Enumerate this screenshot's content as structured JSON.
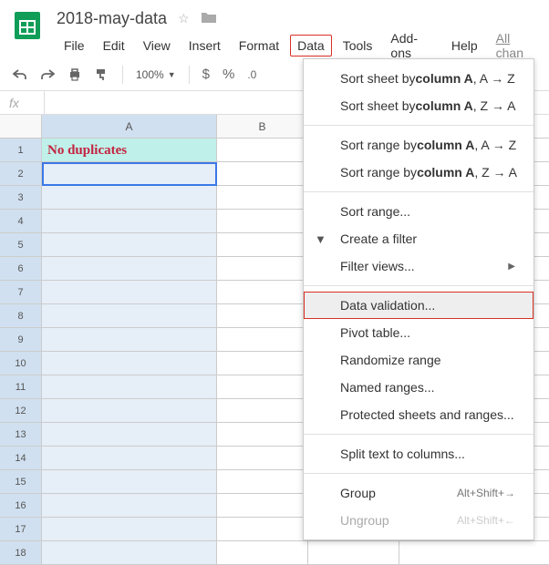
{
  "doc_title": "2018-may-data",
  "menubar": {
    "file": "File",
    "edit": "Edit",
    "view": "View",
    "insert": "Insert",
    "format": "Format",
    "data": "Data",
    "tools": "Tools",
    "addons": "Add-ons",
    "help": "Help",
    "changes": "All chan"
  },
  "toolbar": {
    "zoom": "100%",
    "currency": "$",
    "percent": "%",
    "round0": ".0"
  },
  "fx_label": "fx",
  "cols": {
    "A": "A",
    "B": "B",
    "C": ""
  },
  "rows": [
    "1",
    "2",
    "3",
    "4",
    "5",
    "6",
    "7",
    "8",
    "9",
    "10",
    "11",
    "12",
    "13",
    "14",
    "15",
    "16",
    "17",
    "18"
  ],
  "cell_a1": "No duplicates",
  "menu": {
    "sort_sheet_az_pre": "Sort sheet by ",
    "sort_sheet_az_bold": "column A",
    "sort_sheet_az_post": ", A → Z",
    "sort_sheet_za_pre": "Sort sheet by ",
    "sort_sheet_za_bold": "column A",
    "sort_sheet_za_post": ", Z → A",
    "sort_range_az_pre": "Sort range by ",
    "sort_range_az_bold": "column A",
    "sort_range_az_post": ", A → Z",
    "sort_range_za_pre": "Sort range by ",
    "sort_range_za_bold": "column A",
    "sort_range_za_post": ", Z → A",
    "sort_range": "Sort range...",
    "create_filter": "Create a filter",
    "filter_views": "Filter views...",
    "data_validation": "Data validation...",
    "pivot_table": "Pivot table...",
    "randomize": "Randomize range",
    "named_ranges": "Named ranges...",
    "protected": "Protected sheets and ranges...",
    "split": "Split text to columns...",
    "group": "Group",
    "group_shortcut": "Alt+Shift+→",
    "ungroup": "Ungroup",
    "ungroup_shortcut": "Alt+Shift+←"
  }
}
